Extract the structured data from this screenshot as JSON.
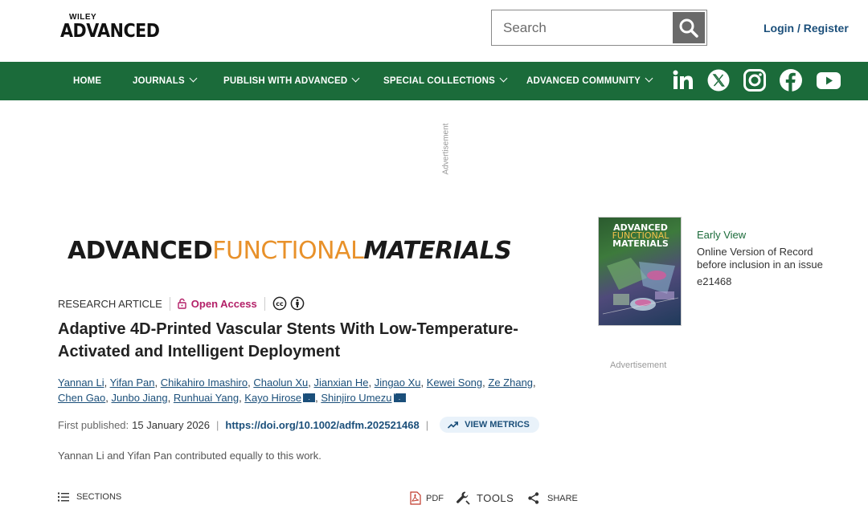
{
  "header": {
    "logo_top": "WILEY",
    "logo_main": "ADVANCED",
    "search_placeholder": "Search",
    "login_label": "Login / Register"
  },
  "nav": {
    "items": [
      {
        "label": "HOME",
        "has_chevron": false
      },
      {
        "label": "JOURNALS",
        "has_chevron": true
      },
      {
        "label": "PUBLISH WITH ADVANCED",
        "has_chevron": true
      },
      {
        "label": "SPECIAL COLLECTIONS",
        "has_chevron": true
      },
      {
        "label": "ADVANCED COMMUNITY",
        "has_chevron": true
      }
    ],
    "social": [
      "linkedin-icon",
      "x-icon",
      "instagram-icon",
      "facebook-icon",
      "youtube-icon"
    ],
    "background": "#1b6b3a"
  },
  "ads": {
    "vertical_label": "Advertisement",
    "right_label": "Advertisement"
  },
  "journal": {
    "name_part1": "ADVANCED",
    "name_part2": "FUNCTIONAL",
    "name_part3": "MATERIALS",
    "accent_color": "#e8912a"
  },
  "article": {
    "type": "RESEARCH ARTICLE",
    "access": "Open Access",
    "title": "Adaptive 4D-Printed Vascular Stents With Low-Temperature-Activated and Intelligent Deployment",
    "authors": [
      {
        "name": "Yannan Li",
        "corresponding": false
      },
      {
        "name": "Yifan Pan",
        "corresponding": false
      },
      {
        "name": "Chikahiro Imashiro",
        "corresponding": false
      },
      {
        "name": "Chaolun Xu",
        "corresponding": false
      },
      {
        "name": "Jianxian He",
        "corresponding": false
      },
      {
        "name": "Jingao Xu",
        "corresponding": false
      },
      {
        "name": "Kewei Song",
        "corresponding": false
      },
      {
        "name": "Ze Zhang",
        "corresponding": false
      },
      {
        "name": "Chen Gao",
        "corresponding": false
      },
      {
        "name": "Junbo Jiang",
        "corresponding": false
      },
      {
        "name": "Runhuai Yang",
        "corresponding": false
      },
      {
        "name": "Kayo Hirose",
        "corresponding": true
      },
      {
        "name": "Shinjiro Umezu",
        "corresponding": true
      }
    ],
    "first_published_label": "First published:",
    "first_published_date": "15 January 2026",
    "doi": "https://doi.org/10.1002/adfm.202521468",
    "metrics_label": "VIEW METRICS",
    "contribution_note": "Yannan Li and Yifan Pan contributed equally to this work."
  },
  "toolbar": {
    "sections_label": "SECTIONS",
    "pdf_label": "PDF",
    "tools_label": "TOOLS",
    "share_label": "SHARE"
  },
  "issue": {
    "cover_title_1": "ADVANCED",
    "cover_title_2": "FUNCTIONAL",
    "cover_title_3": "MATERIALS",
    "status": "Early View",
    "description": "Online Version of Record before inclusion in an issue",
    "article_id": "e21468"
  }
}
